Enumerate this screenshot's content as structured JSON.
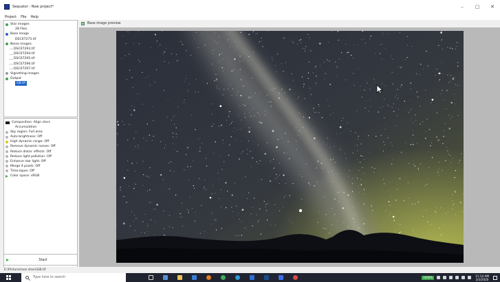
{
  "window": {
    "title": "Sequator - New project*",
    "controls": [
      "–",
      "▢",
      "✕"
    ]
  },
  "menu": [
    "Project",
    "File",
    "Help"
  ],
  "tree": {
    "star_images": "Star images",
    "star_images_count": "28 Files",
    "base_image": "Base image",
    "base_image_file": "DSC07275.tif",
    "noise_images": "Noise images",
    "noise_files": [
      "DSC07293.tif",
      "DSC07294.tif",
      "DSC07295.tif",
      "DSC07296.tif",
      "DSC07297.tif"
    ],
    "vignetting_images": "Vignetting images",
    "output": "Output",
    "output_file": "GB.tif"
  },
  "options": {
    "composition": "Composition: Align stars",
    "accumulation": "Accumulation",
    "items": [
      "Sky region: Full area",
      "Auto brightness: Off",
      "High dynamic range: Off",
      "Remove dynamic noises: Off",
      "Reduce distor. effects: Off",
      "Reduce light pollution: Off",
      "Enhance star light: Off",
      "Merge 4 pixels: Off",
      "Time-lapse: Off",
      "Color space: sRGB"
    ]
  },
  "start_label": "Start",
  "status_path": "E:\\Pictures\\sos stars\\GB.tif",
  "preview": {
    "header": "Base image preview"
  },
  "taskbar": {
    "search_placeholder": "Type here to search",
    "tray_badge": "1000%",
    "time": "11:14 AM",
    "date": "3/3/2020"
  },
  "colors": {
    "accent_green": "#3ea64a",
    "selection_blue": "#1e64c8",
    "taskbar": "#1f2430"
  }
}
